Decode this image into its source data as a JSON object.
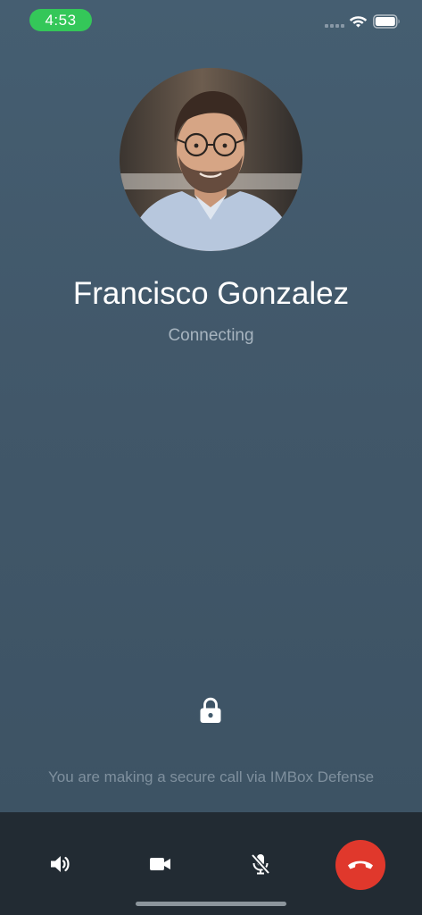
{
  "status_bar": {
    "time": "4:53",
    "time_pill_color": "#34c759",
    "icons": [
      "cellular-signal-icon",
      "wifi-icon",
      "battery-icon"
    ]
  },
  "call": {
    "caller_name": "Francisco Gonzalez",
    "status": "Connecting",
    "secure_note": "You are making a secure call via IMBox Defense",
    "lock_icon": "lock-icon"
  },
  "toolbar": {
    "buttons": [
      {
        "icon": "speaker-icon",
        "action": "speaker"
      },
      {
        "icon": "video-camera-icon",
        "action": "video"
      },
      {
        "icon": "microphone-muted-icon",
        "action": "mute"
      },
      {
        "icon": "end-call-icon",
        "action": "end-call"
      }
    ],
    "end_call_color": "#e0382c",
    "background": "#222b33"
  },
  "colors": {
    "background": "#425a6c",
    "status_text": "#a7b4bf",
    "note_text": "#7f909e"
  }
}
